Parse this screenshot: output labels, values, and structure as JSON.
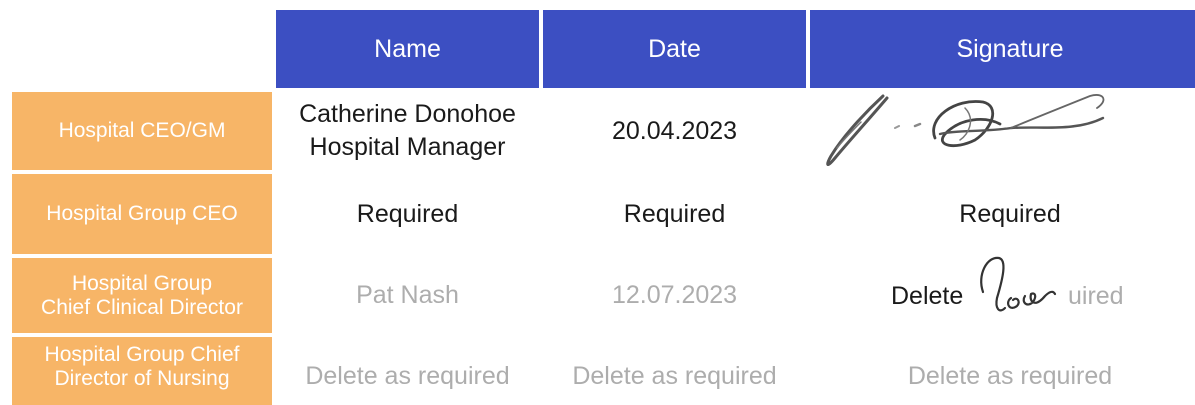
{
  "table": {
    "headers": {
      "name": "Name",
      "date": "Date",
      "signature": "Signature"
    },
    "rows": [
      {
        "role_line1": "Hospital CEO/GM",
        "role_line2": "",
        "name_line1": "Catherine Donohoe",
        "name_line2": "Hospital Manager",
        "date": "20.04.2023",
        "signature": "",
        "signature_image": "handwritten-signature"
      },
      {
        "role_line1": "Hospital Group CEO",
        "role_line2": "",
        "name_line1": "Required",
        "name_line2": "",
        "date": "Required",
        "signature": "Required"
      },
      {
        "role_line1": "Hospital Group",
        "role_line2": "Chief Clinical Director",
        "name_line1": "Pat Nash",
        "name_line2": "",
        "date": "12.07.2023",
        "signature_visible_start": "Delete",
        "signature_visible_end": "uired",
        "signature_image": "handwritten-initials"
      },
      {
        "role_line1": "Hospital Group Chief",
        "role_line2": "Director of Nursing",
        "name_line1": "Delete as required",
        "name_line2": "",
        "date": "Delete as required",
        "signature": "Delete as required"
      }
    ]
  },
  "colors": {
    "header_bg": "#3c4fc2",
    "role_bg": "#f7b567",
    "text_dark": "#1a1a1a",
    "text_light": "#adadad"
  }
}
